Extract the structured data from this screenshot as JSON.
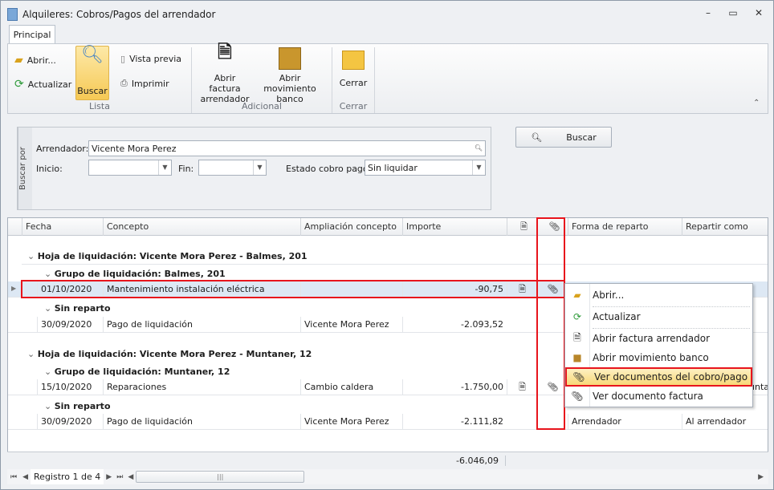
{
  "window": {
    "title": "Alquileres: Cobros/Pagos del arrendador",
    "minimize": "–",
    "restore": "▭",
    "close": "✕"
  },
  "ribbon": {
    "tab": "Principal",
    "abrir": "Abrir...",
    "actualizar": "Actualizar",
    "buscar": "Buscar",
    "vista_previa": "Vista previa",
    "imprimir": "Imprimir",
    "group_lista": "Lista",
    "abrir_factura_1": "Abrir factura",
    "abrir_factura_2": "arrendador",
    "abrir_mov_1": "Abrir movimiento",
    "abrir_mov_2": "banco",
    "group_adicional": "Adicional",
    "cerrar": "Cerrar",
    "group_cerrar": "Cerrar"
  },
  "filter": {
    "label": "Buscar por",
    "arrendador_label": "Arrendador:",
    "arrendador_value": "Vicente Mora Perez",
    "inicio_label": "Inicio:",
    "inicio_value": "",
    "fin_label": "Fin:",
    "fin_value": "",
    "estado_label": "Estado cobro pago:",
    "estado_value": "Sin liquidar",
    "buscar_button": "Buscar"
  },
  "grid": {
    "columns": [
      "Fecha",
      "Concepto",
      "Ampliación concepto",
      "Importe",
      "",
      "",
      "Forma de reparto",
      "Repartir como"
    ],
    "groups": [
      {
        "hoja": "Hoja de liquidación: Vicente Mora Perez - Balmes, 201",
        "grupo": "Grupo de liquidación: Balmes, 201",
        "row": {
          "fecha": "01/10/2020",
          "concepto": "Mantenimiento instalación eléctrica",
          "ampliacion": "",
          "importe": "-90,75",
          "forma": "",
          "repartir": ""
        },
        "sin": "Sin reparto",
        "row2": {
          "fecha": "30/09/2020",
          "concepto": "Pago de liquidación",
          "ampliacion": "Vicente Mora Perez",
          "importe": "-2.093,52",
          "forma": "",
          "repartir": ""
        }
      },
      {
        "hoja": "Hoja de liquidación: Vicente Mora Perez - Muntaner, 12",
        "grupo": "Grupo de liquidación: Muntaner, 12",
        "row": {
          "fecha": "15/10/2020",
          "concepto": "Reparaciones",
          "ampliacion": "Cambio caldera",
          "importe": "-1.750,00",
          "forma": "",
          "repartir": "unta"
        },
        "sin": "Sin reparto",
        "row2": {
          "fecha": "30/09/2020",
          "concepto": "Pago de liquidación",
          "ampliacion": "Vicente Mora Perez",
          "importe": "-2.111,82",
          "forma": "Arrendador",
          "repartir": "Al arrendador"
        }
      }
    ],
    "total": "-6.046,09",
    "nav": {
      "record": "Registro 1 de 4"
    }
  },
  "context_menu": [
    "Abrir...",
    "Actualizar",
    "Abrir factura arrendador",
    "Abrir movimiento banco",
    "Ver documentos del cobro/pago",
    "Ver documento factura"
  ]
}
